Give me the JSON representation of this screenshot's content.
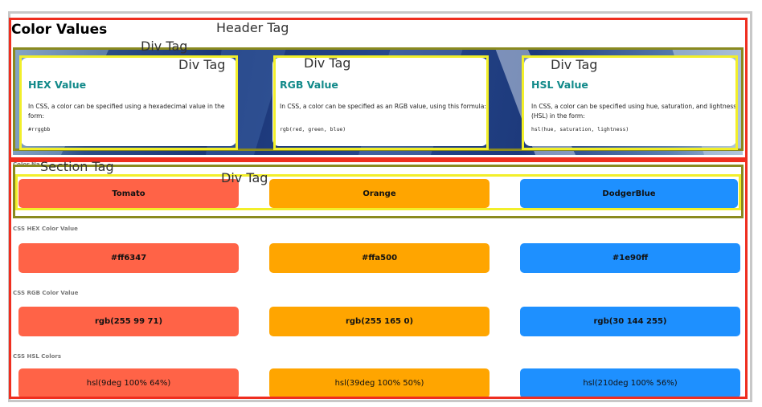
{
  "page": {
    "title": "Color Values",
    "hidden_label": "Color Na"
  },
  "cards": [
    {
      "title": "HEX Value",
      "text": "In CSS, a color can be specified using a hexadecimal value in the form:",
      "code": "#rrggbb"
    },
    {
      "title": "RGB Value",
      "text": "In CSS, a color can be specified as an RGB value, using this formula:",
      "code": "rgb(red, green, blue)"
    },
    {
      "title": "HSL Value",
      "text": "In CSS, a color can be specified using hue, saturation, and lightness (HSL) in the form:",
      "code": "hsl(hue, saturation, lightness)"
    }
  ],
  "colors": {
    "tomato": "#ff6347",
    "orange": "#ffa500",
    "dodgerblue": "#1e90ff"
  },
  "rows": [
    {
      "label": "",
      "values": [
        "Tomato",
        "Orange",
        "DodgerBlue"
      ]
    },
    {
      "label": "CSS HEX Color Value",
      "values": [
        "#ff6347",
        "#ffa500",
        "#1e90ff"
      ]
    },
    {
      "label": "CSS RGB Color Value",
      "values": [
        "rgb(255 99 71)",
        "rgb(255 165 0)",
        "rgb(30 144 255)"
      ]
    },
    {
      "label": "CSS HSL Colors",
      "values": [
        "hsl(9deg 100% 64%)",
        "hsl(39deg 100% 50%)",
        "hsl(210deg 100% 56%)"
      ]
    }
  ],
  "annotations": {
    "header_tag": "Header Tag",
    "div_tag": "Div Tag",
    "section_tag": "Section Tag"
  },
  "annotation_colors": {
    "header_section_box": "#ef2e1f",
    "outer_div_box": "#8a8a1f",
    "inner_div_box": "#f2ef2a"
  }
}
